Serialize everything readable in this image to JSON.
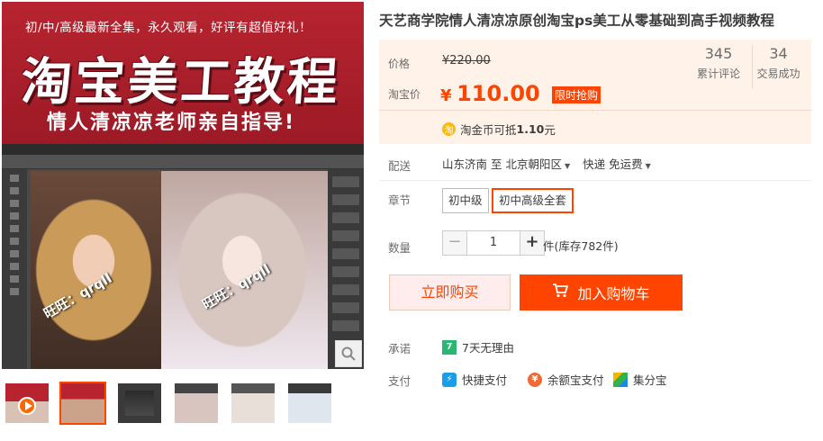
{
  "gallery": {
    "banner_tag": "初/中/高级最新全集，永久观看，好评有超值好礼！",
    "banner_title": "淘宝美工教程",
    "banner_subtitle": "情人清凉凉老师亲自指导!",
    "watermark_left": "旺旺：qrqll",
    "watermark_right": "旺旺：qrqll",
    "zoom_icon": "magnifier-icon",
    "thumbnails": [
      "video-thumb",
      "thumb-2",
      "thumb-3",
      "thumb-4",
      "thumb-5",
      "thumb-6"
    ]
  },
  "product": {
    "title": "天艺商学院情人清凉凉原创淘宝ps美工从零基础到高手视频教程",
    "price_label": "价格",
    "original_price": "¥220.00",
    "promo_label": "淘宝价",
    "currency": "¥",
    "current_price": "110.00",
    "promo_badge": "限时抢购",
    "reviews_count": "345",
    "reviews_label": "累计评论",
    "sales_count": "34",
    "sales_label": "交易成功",
    "coin_icon": "淘",
    "coin_text_prefix": "淘金币可抵",
    "coin_amount": "1.10",
    "coin_text_suffix": "元"
  },
  "delivery": {
    "label": "配送",
    "from": "山东济南",
    "to_word": "至",
    "to": "北京朝阳区",
    "method": "快递 免运费"
  },
  "chapter": {
    "label": "章节",
    "options": [
      "初中级",
      "初中高级全套"
    ],
    "selected_index": 1
  },
  "quantity": {
    "label": "数量",
    "minus": "−",
    "value": "1",
    "plus": "+",
    "stock": "件(库存782件)"
  },
  "actions": {
    "buy_now": "立即购买",
    "add_to_cart": "加入购物车"
  },
  "promise": {
    "label": "承诺",
    "icon": "7",
    "text": "7天无理由"
  },
  "payment": {
    "label": "支付",
    "methods": [
      "快捷支付",
      "余额宝支付",
      "集分宝"
    ]
  },
  "colors": {
    "accent": "#ff4400",
    "price_bg": "#fff2e8"
  }
}
